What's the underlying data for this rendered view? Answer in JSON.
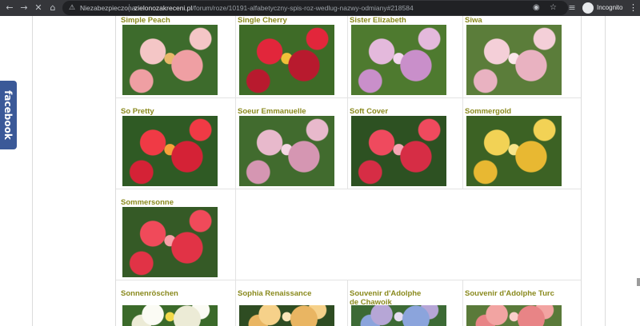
{
  "browser": {
    "security_label": "Niezabezpieczona",
    "url_host": "zielonozakreceni.pl",
    "url_path": "/forum/roze/10191-alfabetyczny-spis-roz-wedlug-nazwy-odmiany#218584",
    "profile_label": "Incognito",
    "icons": [
      "back-icon",
      "forward-icon",
      "stop-icon",
      "home-icon",
      "warning-icon",
      "tracking-protection-icon",
      "bookmark-star-icon",
      "media-icon",
      "incognito-icon",
      "menu-icon"
    ]
  },
  "social": {
    "facebook_label": "facebook"
  },
  "roses": [
    {
      "name": "Simple Peach",
      "colors": [
        "#f4c6c6",
        "#ef9fa3",
        "#e8b86a",
        "#3d6b2c"
      ]
    },
    {
      "name": "Single Cherry",
      "colors": [
        "#e2263b",
        "#b81a2e",
        "#f1c038",
        "#3e6b27"
      ]
    },
    {
      "name": "Sister Elizabeth",
      "colors": [
        "#e4b9dc",
        "#c98fca",
        "#f3d5ee",
        "#4e7a2f"
      ]
    },
    {
      "name": "Siwa",
      "colors": [
        "#f4cfd8",
        "#e9b2c1",
        "#fbe6ea",
        "#5b7d3a"
      ]
    },
    {
      "name": "So Pretty",
      "colors": [
        "#f03a45",
        "#d42236",
        "#f6a23a",
        "#2f5a24"
      ]
    },
    {
      "name": "Soeur Emmanuelle",
      "colors": [
        "#e8b9cc",
        "#d596b2",
        "#f4d6e2",
        "#416b2e"
      ]
    },
    {
      "name": "Soft Cover",
      "colors": [
        "#ef4a5e",
        "#d62d45",
        "#f7a6b4",
        "#2d5122"
      ]
    },
    {
      "name": "Sommergold",
      "colors": [
        "#f2d255",
        "#e8b832",
        "#f8e58a",
        "#3c6224"
      ]
    },
    {
      "name": "Sommersonne",
      "colors": [
        "#f04a5a",
        "#e13346",
        "#f8a0a8",
        "#355a26"
      ]
    },
    {
      "name": "Sonnenröschen",
      "colors": [
        "#fbfbf4",
        "#ecebd6",
        "#f2d94a",
        "#3b6a2a"
      ]
    },
    {
      "name": "Sophia Renaissance",
      "colors": [
        "#f6d18a",
        "#e9b562",
        "#fbe6b8",
        "#2e4c22"
      ]
    },
    {
      "name": "Souvenir d'Adolphe de Chawoik",
      "colors": [
        "#b6a6d6",
        "#8ba4dc",
        "#e6ddf2",
        "#3c6a35"
      ]
    },
    {
      "name": "Souvenir d'Adolphe Turc",
      "colors": [
        "#f2a4a2",
        "#e88486",
        "#f9cfcb",
        "#5a7a3a"
      ]
    }
  ]
}
